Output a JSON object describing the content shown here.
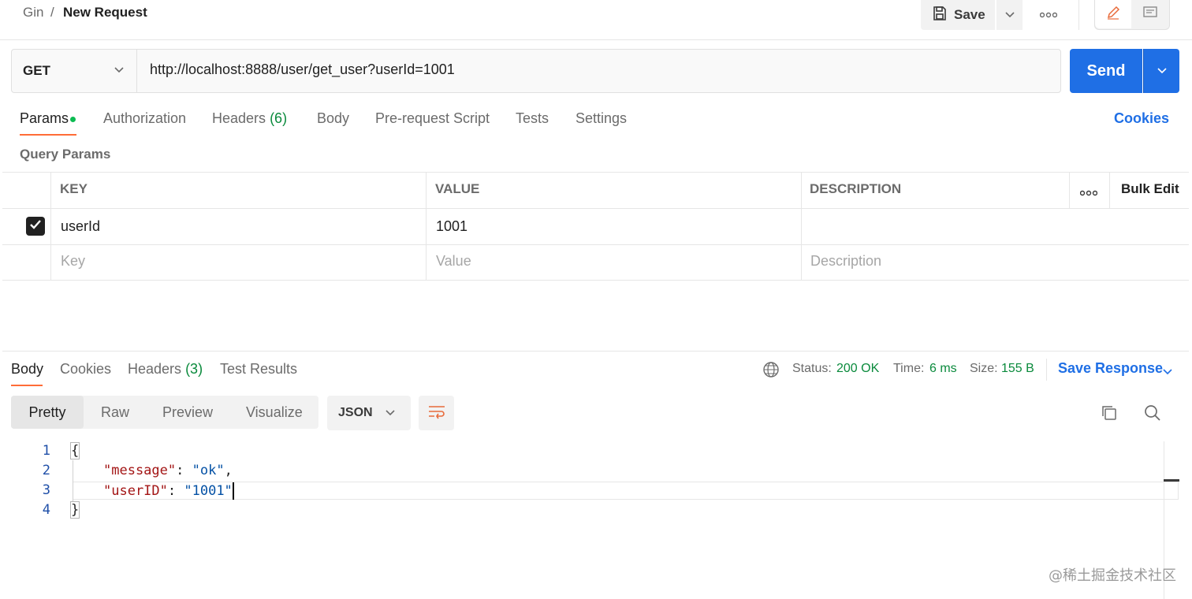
{
  "breadcrumb": {
    "parent": "Gin",
    "separator": "/",
    "current": "New Request"
  },
  "toolbar": {
    "save_label": "Save"
  },
  "request": {
    "method": "GET",
    "url": "http://localhost:8888/user/get_user?userId=1001",
    "send_label": "Send"
  },
  "request_tabs": [
    {
      "label": "Params",
      "active": true
    },
    {
      "label": "Authorization"
    },
    {
      "label": "Headers",
      "count": "(6)"
    },
    {
      "label": "Body"
    },
    {
      "label": "Pre-request Script"
    },
    {
      "label": "Tests"
    },
    {
      "label": "Settings"
    }
  ],
  "cookies_label": "Cookies",
  "query_params": {
    "title": "Query Params",
    "columns": {
      "key": "KEY",
      "value": "VALUE",
      "description": "DESCRIPTION"
    },
    "bulk_edit_label": "Bulk Edit",
    "rows": [
      {
        "checked": true,
        "key": "userId",
        "value": "1001",
        "description": ""
      }
    ],
    "placeholders": {
      "key": "Key",
      "value": "Value",
      "description": "Description"
    }
  },
  "response_tabs": [
    {
      "label": "Body",
      "active": true
    },
    {
      "label": "Cookies"
    },
    {
      "label": "Headers",
      "count": "(3)"
    },
    {
      "label": "Test Results"
    }
  ],
  "response_meta": {
    "status_label": "Status:",
    "status_value": "200 OK",
    "time_label": "Time:",
    "time_value": "6 ms",
    "size_label": "Size:",
    "size_value": "155 B",
    "save_response_label": "Save Response"
  },
  "view_modes": [
    "Pretty",
    "Raw",
    "Preview",
    "Visualize"
  ],
  "format": "JSON",
  "code": {
    "line_numbers": [
      "1",
      "2",
      "3",
      "4"
    ],
    "open_brace": "{",
    "close_brace": "}",
    "fields": [
      {
        "key": "\"message\"",
        "value": "\"ok\"",
        "trailing": ","
      },
      {
        "key": "\"userID\"",
        "value": "\"1001\"",
        "trailing": ""
      }
    ]
  },
  "watermark": "@稀土掘金技术社区",
  "colors": {
    "accent_orange": "#ff6c37",
    "primary_blue": "#1f6fe5",
    "status_green": "#0a8a3c"
  }
}
